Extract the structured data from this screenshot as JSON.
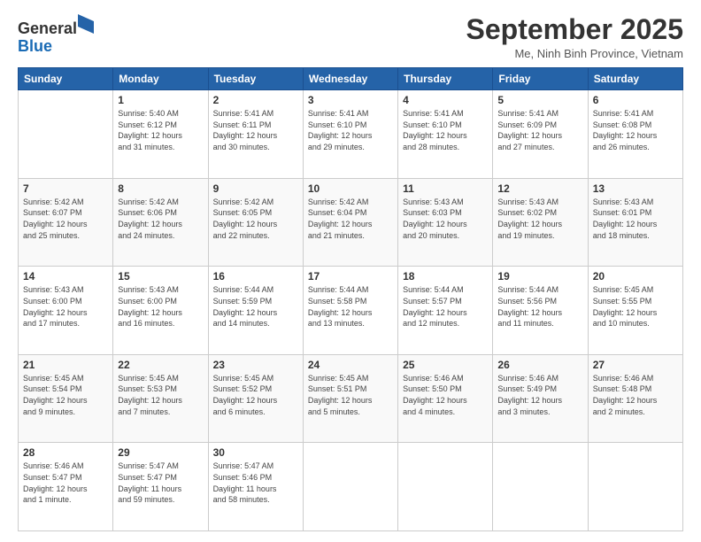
{
  "header": {
    "logo_general": "General",
    "logo_blue": "Blue",
    "month_title": "September 2025",
    "location": "Me, Ninh Binh Province, Vietnam"
  },
  "weekdays": [
    "Sunday",
    "Monday",
    "Tuesday",
    "Wednesday",
    "Thursday",
    "Friday",
    "Saturday"
  ],
  "weeks": [
    [
      {
        "day": "",
        "info": ""
      },
      {
        "day": "1",
        "info": "Sunrise: 5:40 AM\nSunset: 6:12 PM\nDaylight: 12 hours\nand 31 minutes."
      },
      {
        "day": "2",
        "info": "Sunrise: 5:41 AM\nSunset: 6:11 PM\nDaylight: 12 hours\nand 30 minutes."
      },
      {
        "day": "3",
        "info": "Sunrise: 5:41 AM\nSunset: 6:10 PM\nDaylight: 12 hours\nand 29 minutes."
      },
      {
        "day": "4",
        "info": "Sunrise: 5:41 AM\nSunset: 6:10 PM\nDaylight: 12 hours\nand 28 minutes."
      },
      {
        "day": "5",
        "info": "Sunrise: 5:41 AM\nSunset: 6:09 PM\nDaylight: 12 hours\nand 27 minutes."
      },
      {
        "day": "6",
        "info": "Sunrise: 5:41 AM\nSunset: 6:08 PM\nDaylight: 12 hours\nand 26 minutes."
      }
    ],
    [
      {
        "day": "7",
        "info": "Sunrise: 5:42 AM\nSunset: 6:07 PM\nDaylight: 12 hours\nand 25 minutes."
      },
      {
        "day": "8",
        "info": "Sunrise: 5:42 AM\nSunset: 6:06 PM\nDaylight: 12 hours\nand 24 minutes."
      },
      {
        "day": "9",
        "info": "Sunrise: 5:42 AM\nSunset: 6:05 PM\nDaylight: 12 hours\nand 22 minutes."
      },
      {
        "day": "10",
        "info": "Sunrise: 5:42 AM\nSunset: 6:04 PM\nDaylight: 12 hours\nand 21 minutes."
      },
      {
        "day": "11",
        "info": "Sunrise: 5:43 AM\nSunset: 6:03 PM\nDaylight: 12 hours\nand 20 minutes."
      },
      {
        "day": "12",
        "info": "Sunrise: 5:43 AM\nSunset: 6:02 PM\nDaylight: 12 hours\nand 19 minutes."
      },
      {
        "day": "13",
        "info": "Sunrise: 5:43 AM\nSunset: 6:01 PM\nDaylight: 12 hours\nand 18 minutes."
      }
    ],
    [
      {
        "day": "14",
        "info": "Sunrise: 5:43 AM\nSunset: 6:00 PM\nDaylight: 12 hours\nand 17 minutes."
      },
      {
        "day": "15",
        "info": "Sunrise: 5:43 AM\nSunset: 6:00 PM\nDaylight: 12 hours\nand 16 minutes."
      },
      {
        "day": "16",
        "info": "Sunrise: 5:44 AM\nSunset: 5:59 PM\nDaylight: 12 hours\nand 14 minutes."
      },
      {
        "day": "17",
        "info": "Sunrise: 5:44 AM\nSunset: 5:58 PM\nDaylight: 12 hours\nand 13 minutes."
      },
      {
        "day": "18",
        "info": "Sunrise: 5:44 AM\nSunset: 5:57 PM\nDaylight: 12 hours\nand 12 minutes."
      },
      {
        "day": "19",
        "info": "Sunrise: 5:44 AM\nSunset: 5:56 PM\nDaylight: 12 hours\nand 11 minutes."
      },
      {
        "day": "20",
        "info": "Sunrise: 5:45 AM\nSunset: 5:55 PM\nDaylight: 12 hours\nand 10 minutes."
      }
    ],
    [
      {
        "day": "21",
        "info": "Sunrise: 5:45 AM\nSunset: 5:54 PM\nDaylight: 12 hours\nand 9 minutes."
      },
      {
        "day": "22",
        "info": "Sunrise: 5:45 AM\nSunset: 5:53 PM\nDaylight: 12 hours\nand 7 minutes."
      },
      {
        "day": "23",
        "info": "Sunrise: 5:45 AM\nSunset: 5:52 PM\nDaylight: 12 hours\nand 6 minutes."
      },
      {
        "day": "24",
        "info": "Sunrise: 5:45 AM\nSunset: 5:51 PM\nDaylight: 12 hours\nand 5 minutes."
      },
      {
        "day": "25",
        "info": "Sunrise: 5:46 AM\nSunset: 5:50 PM\nDaylight: 12 hours\nand 4 minutes."
      },
      {
        "day": "26",
        "info": "Sunrise: 5:46 AM\nSunset: 5:49 PM\nDaylight: 12 hours\nand 3 minutes."
      },
      {
        "day": "27",
        "info": "Sunrise: 5:46 AM\nSunset: 5:48 PM\nDaylight: 12 hours\nand 2 minutes."
      }
    ],
    [
      {
        "day": "28",
        "info": "Sunrise: 5:46 AM\nSunset: 5:47 PM\nDaylight: 12 hours\nand 1 minute."
      },
      {
        "day": "29",
        "info": "Sunrise: 5:47 AM\nSunset: 5:47 PM\nDaylight: 11 hours\nand 59 minutes."
      },
      {
        "day": "30",
        "info": "Sunrise: 5:47 AM\nSunset: 5:46 PM\nDaylight: 11 hours\nand 58 minutes."
      },
      {
        "day": "",
        "info": ""
      },
      {
        "day": "",
        "info": ""
      },
      {
        "day": "",
        "info": ""
      },
      {
        "day": "",
        "info": ""
      }
    ]
  ]
}
